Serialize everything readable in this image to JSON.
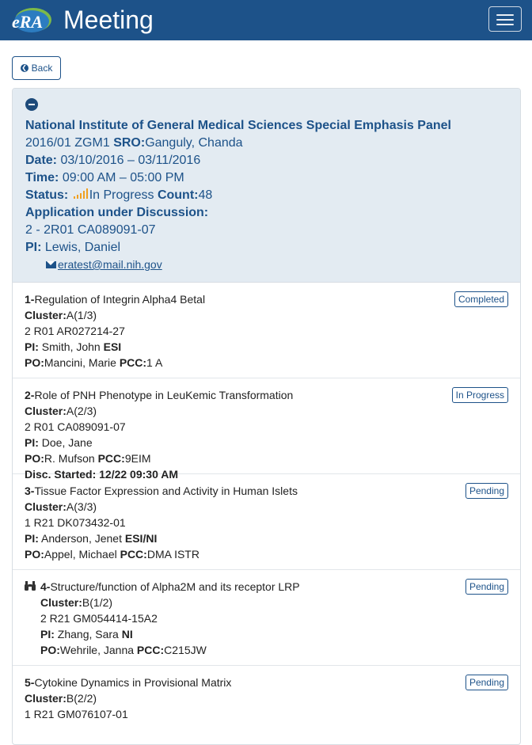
{
  "header": {
    "logo_text": "eRA",
    "title": "Meeting"
  },
  "back_label": "Back",
  "meeting": {
    "name": "National Institute of General Medical Sciences Special Emphasis Panel",
    "code": "2016/01 ZGM1",
    "sro_label": "SRO:",
    "sro": "Ganguly, Chanda",
    "date_label": "Date:",
    "date": "03/10/2016 – 03/11/2016",
    "time_label": "Time:",
    "time": "09:00 AM – 05:00 PM",
    "status_label": "Status:",
    "status": "In Progress",
    "count_label": "Count:",
    "count": "48",
    "app_label": "Application under Discussion:",
    "app": "2 - 2R01 CA089091-07",
    "pi_label": "PI:",
    "pi": "Lewis, Daniel",
    "email": "eratest@mail.nih.gov"
  },
  "colors": {
    "brand": "#1d5289",
    "header_bg": "#e3ebf2",
    "signal": "#f0a020"
  },
  "items": [
    {
      "num": "1-",
      "title": "Regulation of Integrin Alpha4 Betal",
      "cluster_label": "Cluster:",
      "cluster": "A(1/3)",
      "grant": "2 R01 AR027214-27",
      "pi_label": "PI:",
      "pi": "Smith, John",
      "pi_flag": "ESI",
      "po_label": "PO:",
      "po": "Mancini, Marie",
      "pcc_label": "PCC:",
      "pcc": "1 A",
      "status": "Completed"
    },
    {
      "num": "2-",
      "title": "Role of PNH Phenotype in LeuKemic Transformation",
      "cluster_label": "Cluster:",
      "cluster": "A(2/3)",
      "grant": "2 R01 CA089091-07",
      "pi_label": "PI:",
      "pi": "Doe, Jane",
      "po_label": "PO:",
      "po": "R. Mufson",
      "pcc_label": "PCC:",
      "pcc": "9EIM",
      "disc": "Disc. Started: 12/22 09:30 AM",
      "status": "In Progress"
    },
    {
      "num": "3-",
      "title": "Tissue Factor Expression and Activity in Human Islets",
      "cluster_label": "Cluster:",
      "cluster": "A(3/3)",
      "grant": "1 R21 DK073432-01",
      "pi_label": "PI:",
      "pi": "Anderson, Jenet",
      "pi_flag": "ESI/NI",
      "po_label": "PO:",
      "po": "Appel, Michael",
      "pcc_label": "PCC:",
      "pcc": "DMA ISTR",
      "status": "Pending"
    },
    {
      "num": "4-",
      "title": "Structure/function of Alpha2M and its receptor LRP",
      "cluster_label": "Cluster:",
      "cluster": "B(1/2)",
      "grant": "2 R21 GM054414-15A2",
      "pi_label": "PI:",
      "pi": "Zhang, Sara",
      "pi_flag": "NI",
      "po_label": "PO:",
      "po": "Wehrile, Janna",
      "pcc_label": "PCC:",
      "pcc": "C215JW",
      "status": "Pending",
      "icon": "binoculars-icon"
    },
    {
      "num": "5-",
      "title": "Cytokine Dynamics in Provisional Matrix",
      "cluster_label": "Cluster:",
      "cluster": "B(2/2)",
      "grant": "1 R21 GM076107-01",
      "status": "Pending"
    }
  ]
}
